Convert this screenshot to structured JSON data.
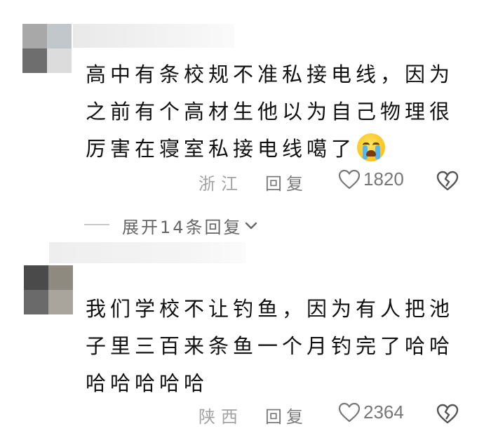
{
  "comments": [
    {
      "text": "高中有条校规不准私接电线，因为之前有个高材生他以为自己物理很厉害在寝室私接电线噶了",
      "emoji": "loudly-crying-face-icon",
      "location": "浙江",
      "reply_label": "回复",
      "like_count": "1820"
    },
    {
      "text": "我们学校不让钓鱼，因为有人把池子里三百来条鱼一个月钓完了哈哈哈哈哈哈哈",
      "location": "陕西",
      "reply_label": "回复",
      "like_count": "2364"
    }
  ],
  "expand_replies": {
    "label": "展开14条回复"
  },
  "colors": {
    "text": "#111111",
    "meta": "#9a9a9a",
    "icon": "#777777"
  }
}
